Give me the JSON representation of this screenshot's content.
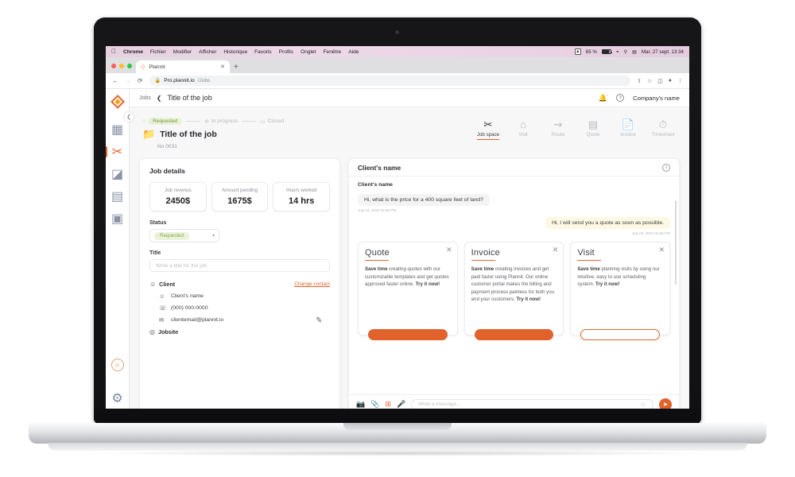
{
  "menubar": {
    "apple": "",
    "app": "Chrome",
    "items": [
      "Fichier",
      "Modifier",
      "Afficher",
      "Historique",
      "Favoris",
      "Profils",
      "Onglet",
      "Fenêtre",
      "Aide"
    ],
    "battery_pct": "85 %",
    "datetime": "Mar. 27 sept.  13:34",
    "icons": [
      "shield-badge-icon",
      "battery-icon",
      "wifi-icon",
      "search-icon",
      "control-center-icon"
    ]
  },
  "browser": {
    "tab_title": "Plannit",
    "tab_favicon": "plannit-logo-icon",
    "tab_close": "✕",
    "new_tab": "+",
    "back": "←",
    "forward": "→",
    "reload": "⟳",
    "lock": "🔒",
    "url_domain": "Pro.plannit.io",
    "url_path": "/Jobs",
    "right_icons": [
      "share-icon",
      "bookmark-star-icon",
      "side-panel-icon",
      "profile-icon",
      "kebab-menu-icon"
    ]
  },
  "sidebar": {
    "logo": "plannit-logo",
    "collapse": "❮",
    "items": [
      {
        "name": "dashboard",
        "glyph": "▦"
      },
      {
        "name": "jobs-tools",
        "glyph": "✂"
      },
      {
        "name": "analytics",
        "glyph": "◪"
      },
      {
        "name": "files",
        "glyph": "▤"
      },
      {
        "name": "contacts",
        "glyph": "▣"
      }
    ],
    "active_index": 1,
    "help_glyph": "☺",
    "settings_glyph": "⚙"
  },
  "header": {
    "breadcrumb_root": "Jobs",
    "breadcrumb_chevron": "❮",
    "breadcrumb_current": "Title of the job",
    "bell": "notification-bell",
    "help": "?",
    "company": "Company's name"
  },
  "job": {
    "steps": [
      {
        "label": "Requested",
        "state": "done",
        "glyph": "◌"
      },
      {
        "label": "In progress",
        "state": "todo",
        "glyph": "✲"
      },
      {
        "label": "Closed",
        "state": "todo",
        "glyph": "▭"
      }
    ],
    "folder_icon": "folder-icon",
    "title": "Title of the job",
    "number": "No 0031"
  },
  "tabs": [
    {
      "label": "Job space",
      "icon": "tools-icon",
      "glyph": "✂",
      "active": true
    },
    {
      "label": "Visit",
      "icon": "house-visit-icon",
      "glyph": "⌂",
      "active": false
    },
    {
      "label": "Route",
      "icon": "route-icon",
      "glyph": "↝",
      "active": false
    },
    {
      "label": "Quote",
      "icon": "calculator-icon",
      "glyph": "▥",
      "active": false
    },
    {
      "label": "Invoice",
      "icon": "invoice-doc-icon",
      "glyph": "▤",
      "active": false
    },
    {
      "label": "Timesheet",
      "icon": "clock-icon",
      "glyph": "◷",
      "active": false
    }
  ],
  "job_details": {
    "title": "Job details",
    "stats": [
      {
        "label": "Job revenus",
        "value": "2450$"
      },
      {
        "label": "Amount pending",
        "value": "1675$"
      },
      {
        "label": "Hours worked",
        "value": "14 hrs"
      }
    ],
    "status_label": "Status",
    "status_value": "Requested",
    "status_chevron": "▾",
    "title_label": "Title",
    "title_placeholder": "Write a title for the job",
    "client_section": "Client",
    "change_contact": "Change contact",
    "client_name": "Client's name",
    "client_phone": "(000) 000-0000",
    "client_email": "clientemail@plannit.io",
    "edit_icon": "pencil-edit-icon",
    "jobsite_section": "Jobsite"
  },
  "chat": {
    "header_name": "Client's name",
    "info_icon": "i",
    "sender": "Client's name",
    "incoming_text": "Hi, what is the price for a 400 square feet of land?",
    "incoming_time": "July 04, 2022 04:56 PM",
    "outgoing_text": "Hi, I will send you a quote as soon as possible.",
    "outgoing_time": "July 04, 2022 04:56 PM",
    "promos": [
      {
        "title": "Quote",
        "close": "✕",
        "bold": "Save time",
        "text": " creating quotes with our customizable templates and get quotes approved faster online. ",
        "cta": "Try it now!"
      },
      {
        "title": "Invoice",
        "close": "✕",
        "bold": "Save time",
        "text": " creating invoices and get paid faster using Plannit. Our online customer portal makes the billing and payment process painless for both you and your customers. ",
        "cta": "Try it now!"
      },
      {
        "title": "Visit",
        "close": "✕",
        "bold": "Save time",
        "text": " planning visits by using our intuitive, easy to use scheduling system. ",
        "cta": "Try it now!"
      }
    ],
    "composer": {
      "camera": "camera-icon",
      "attach": "paperclip-icon",
      "template": "template-icon",
      "mic": "microphone-icon",
      "placeholder": "Write a message...",
      "emoji": "☺",
      "send": "➤"
    }
  },
  "colors": {
    "accent": "#e2622c",
    "status_green": "#8ba355",
    "status_green_bg": "#eaf3d8",
    "outgoing_bubble": "#fdf8e3"
  }
}
